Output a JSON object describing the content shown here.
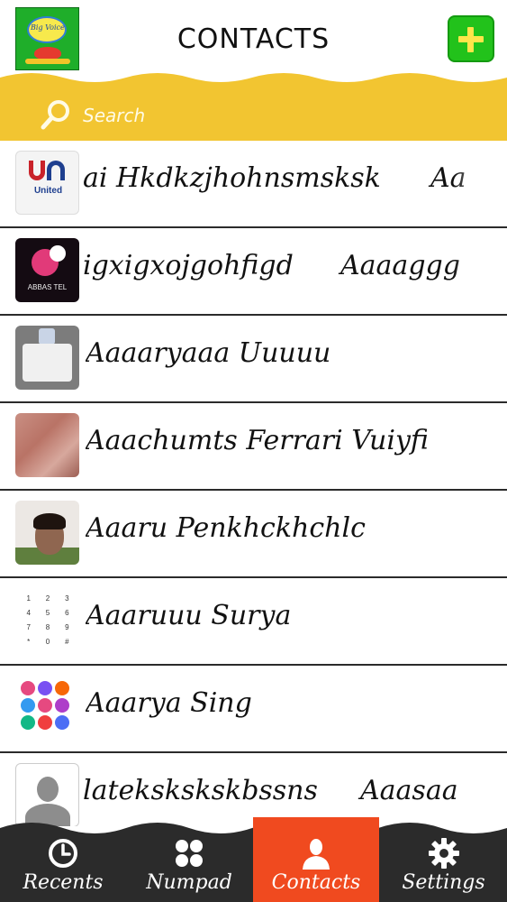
{
  "header": {
    "title": "CONTACTS",
    "logo_text": "Big Voice",
    "add_icon": "plus-icon"
  },
  "search": {
    "placeholder": "Search",
    "icon": "search-icon"
  },
  "colors": {
    "accent_yellow": "#f2c531",
    "tab_active": "#f04a1f",
    "tab_bar": "#2b2b2b",
    "add_button": "#22c21b"
  },
  "contacts": [
    {
      "name": "ai Hkdkzjhohnsmsksk",
      "extra": "Aa",
      "thumb": "united-fone",
      "thumb_label": "United"
    },
    {
      "name": "igxigxojgohfigd",
      "extra": "Aaaaggg",
      "thumb": "abbas-tel",
      "thumb_label": "ABBAS TEL"
    },
    {
      "name": "Aaaaryaaa Uuuuu",
      "extra": "",
      "thumb": "dialog-screenshot",
      "thumb_label": ""
    },
    {
      "name": "Aaachumts Ferrari Vuiyfi",
      "extra": "",
      "thumb": "photo",
      "thumb_label": ""
    },
    {
      "name": "Aaaru Penkhckhchlc",
      "extra": "",
      "thumb": "photo-person",
      "thumb_label": ""
    },
    {
      "name": "Aaaruuu Surya",
      "extra": "",
      "thumb": "dialpad",
      "thumb_label": ""
    },
    {
      "name": "Aaarya Sing",
      "extra": "",
      "thumb": "color-keypad",
      "thumb_label": ""
    },
    {
      "name": "latekskskskbssns",
      "extra": "Aaasaa",
      "thumb": "default-avatar",
      "thumb_label": ""
    }
  ],
  "dialpad_keys": [
    "1",
    "2",
    "3",
    "4",
    "5",
    "6",
    "7",
    "8",
    "9",
    "*",
    "0",
    "#"
  ],
  "tabs": [
    {
      "label": "Recents",
      "icon": "clock-icon",
      "active": false
    },
    {
      "label": "Numpad",
      "icon": "numpad-icon",
      "active": false
    },
    {
      "label": "Contacts",
      "icon": "person-icon",
      "active": true
    },
    {
      "label": "Settings",
      "icon": "gear-icon",
      "active": false
    }
  ]
}
